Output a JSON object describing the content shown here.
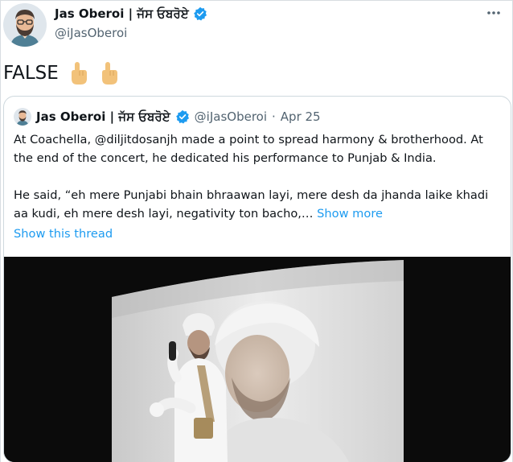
{
  "author": {
    "name": "Jas Oberoi | ਜੱਸ ਓਬਰੋਏ",
    "handle": "@iJasOberoi"
  },
  "tweet": {
    "text": "FALSE"
  },
  "quoted": {
    "name": "Jas Oberoi | ਜੱਸ ਓਬਰੋਏ",
    "handle": "@iJasOberoi",
    "separator": "·",
    "date": "Apr 25",
    "paragraph1": "At Coachella, @diljitdosanjh made a point to spread harmony & brotherhood. At the end of the concert, he dedicated his performance to Punjab & India.",
    "paragraph2": "He said, “eh mere Punjabi bhain bhraawan layi, mere desh da jhanda laike khadi aa kudi, eh mere desh layi, negativity ton bacho,…",
    "show_more": "Show more",
    "show_thread": "Show this thread"
  },
  "colors": {
    "accent": "#1d9bf0",
    "secondary_text": "#536471",
    "border": "#cfd9de"
  },
  "icons": {
    "verified": "verified-badge-icon",
    "hand": "pointing-up-hand-icon",
    "more": "more-options-icon"
  }
}
